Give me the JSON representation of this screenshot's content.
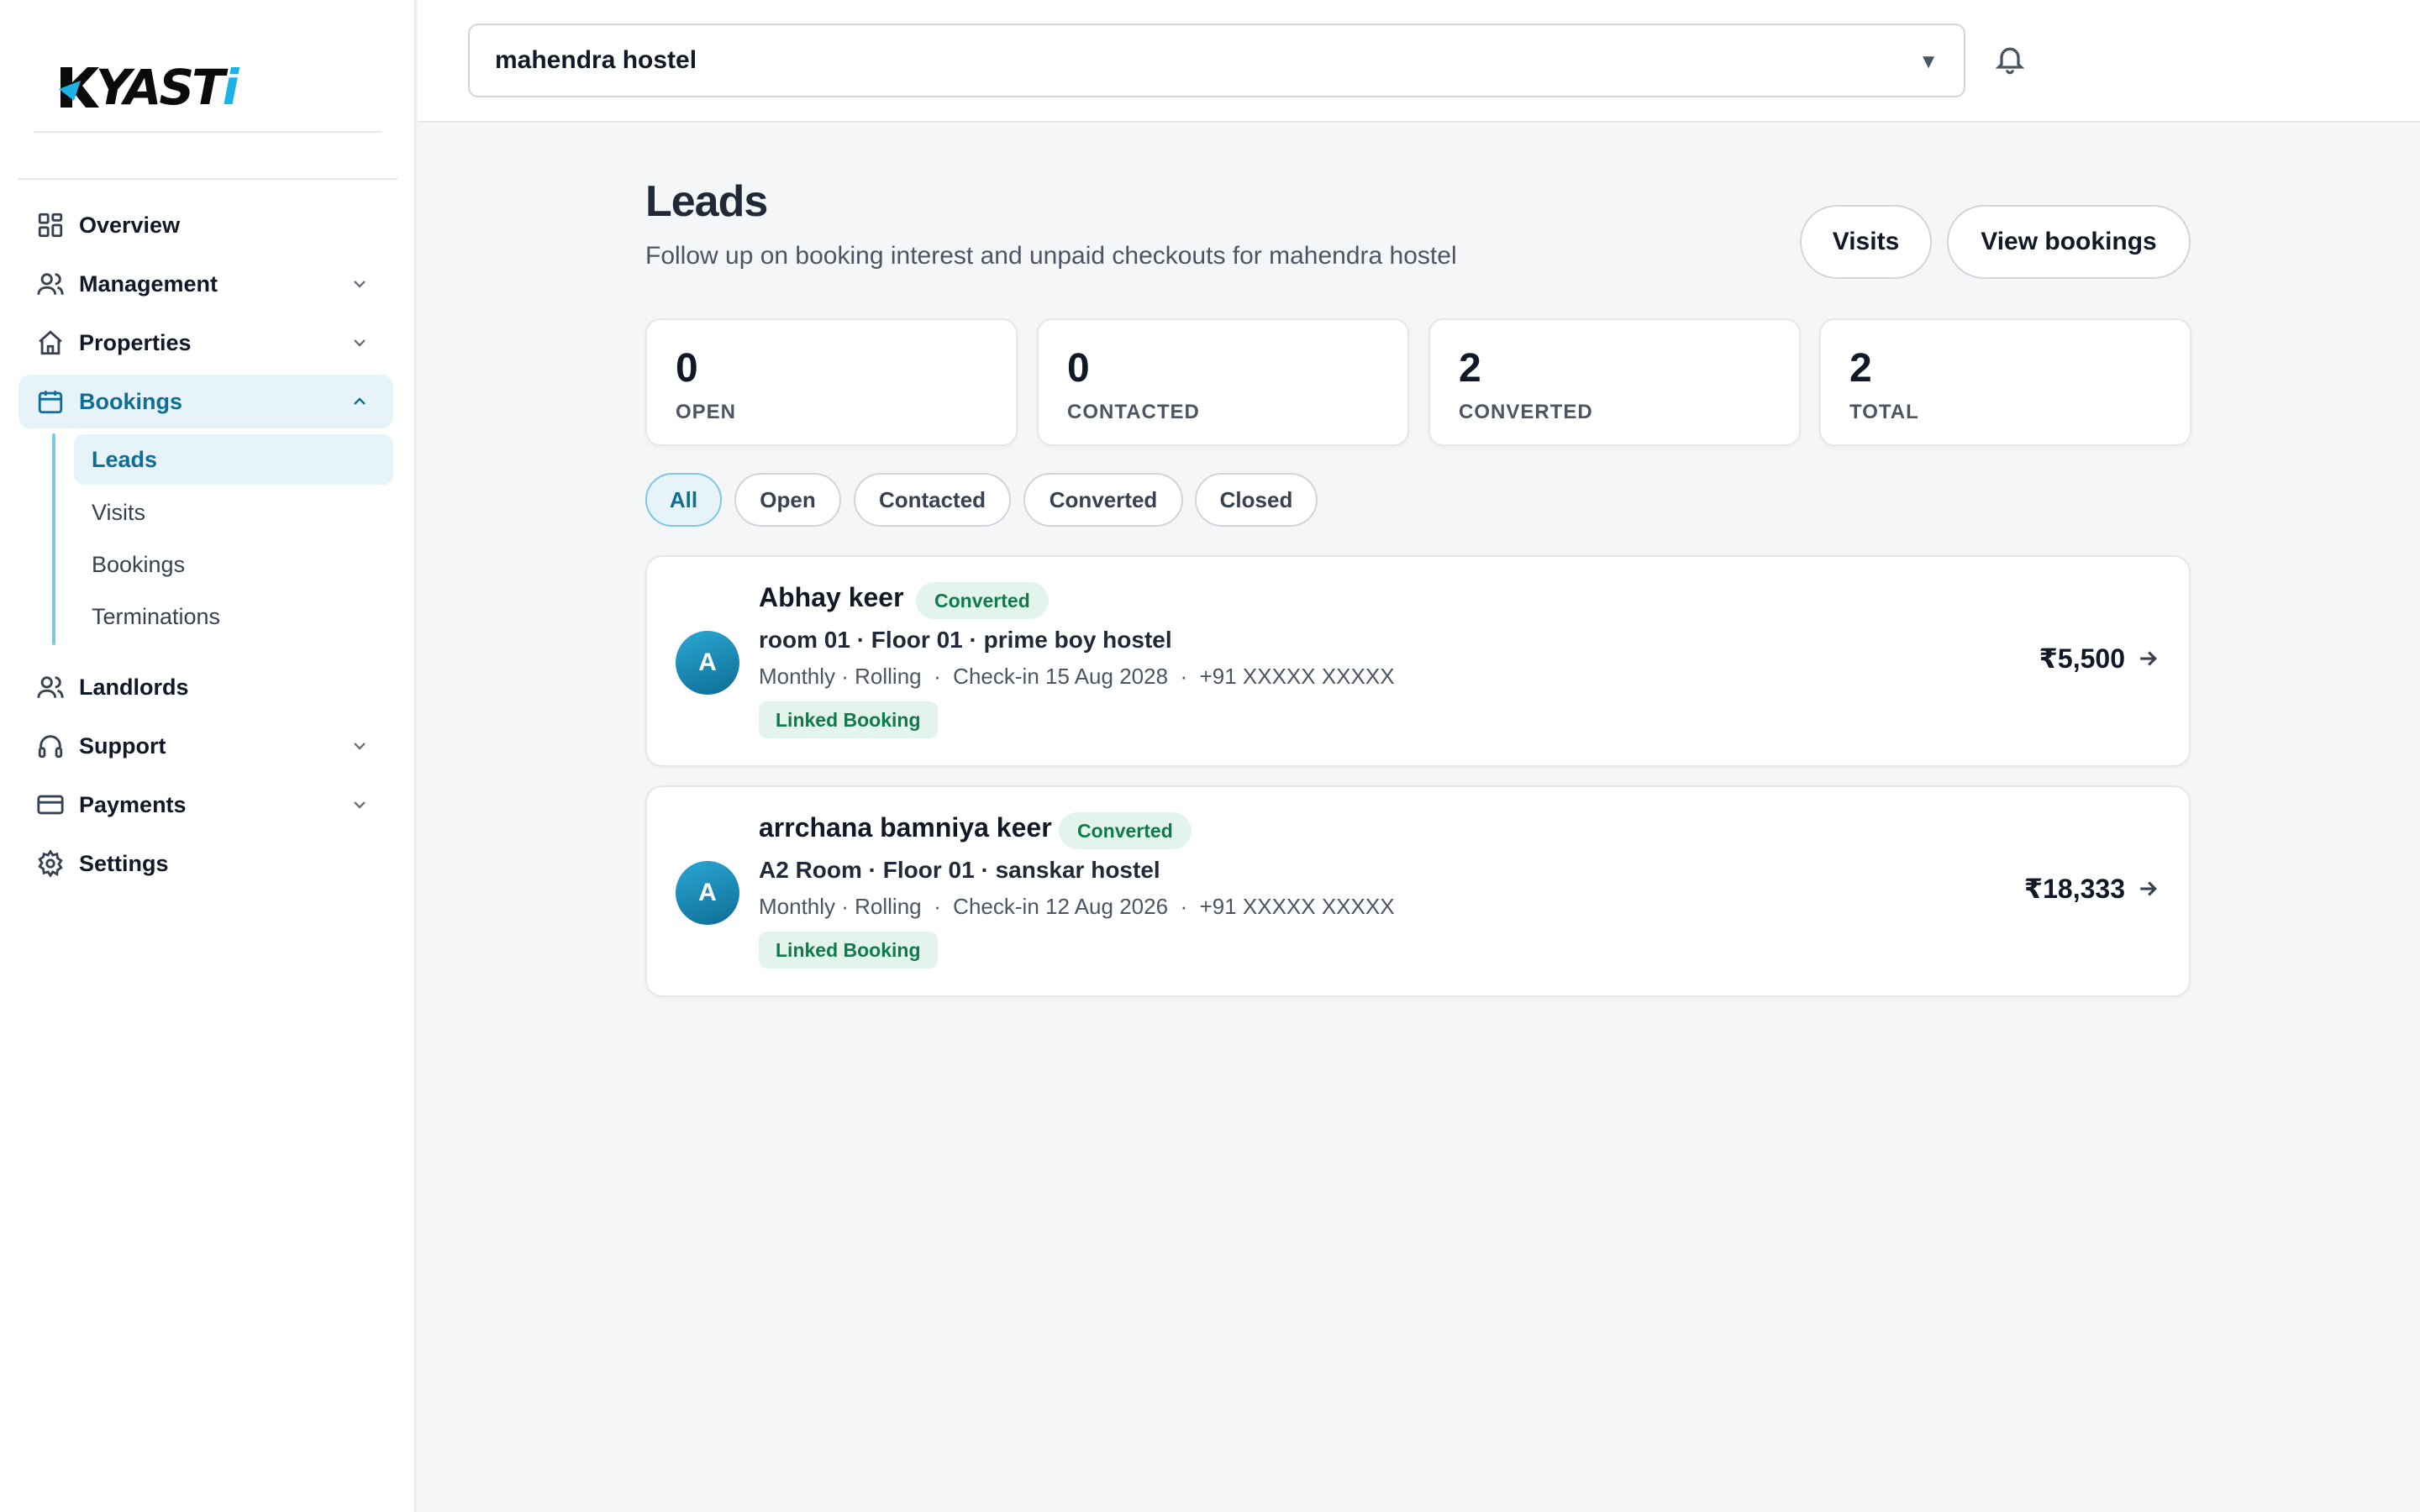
{
  "brand": {
    "logo_text": "KYASTi",
    "logo_main": "YAST",
    "logo_dot": "i"
  },
  "sidebar": {
    "items": [
      {
        "label": "Overview",
        "icon": "grid-icon"
      },
      {
        "label": "Management",
        "icon": "users-icon"
      },
      {
        "label": "Properties",
        "icon": "home-icon"
      },
      {
        "label": "Bookings",
        "icon": "calendar-icon"
      },
      {
        "label": "Landlords",
        "icon": "users-icon"
      },
      {
        "label": "Support",
        "icon": "headset-icon"
      },
      {
        "label": "Payments",
        "icon": "credit-card-icon"
      },
      {
        "label": "Settings",
        "icon": "gear-icon"
      }
    ],
    "bookings_sub": [
      {
        "label": "Leads",
        "active": true
      },
      {
        "label": "Visits"
      },
      {
        "label": "Bookings"
      },
      {
        "label": "Terminations"
      }
    ]
  },
  "topbar": {
    "property_selector": "mahendra hostel",
    "caret": "▼"
  },
  "header": {
    "title": "Leads",
    "subtitle": "Follow up on booking interest and unpaid checkouts for mahendra hostel",
    "visits_button": "Visits",
    "view_bookings_button": "View bookings"
  },
  "stats": [
    {
      "value": "0",
      "label": "OPEN"
    },
    {
      "value": "0",
      "label": "CONTACTED"
    },
    {
      "value": "2",
      "label": "CONVERTED"
    },
    {
      "value": "2",
      "label": "TOTAL"
    }
  ],
  "filters": [
    "All",
    "Open",
    "Contacted",
    "Converted",
    "Closed"
  ],
  "active_filter": "All",
  "leads": [
    {
      "initial": "A",
      "name": "Abhay keer",
      "status": "Converted",
      "room": "room 01 · Floor 01 · prime boy hostel",
      "meta": "Monthly · Rolling  ·  Check-in 15 Aug 2028  ·  +91 XXXXX XXXXX",
      "tag": "Linked Booking",
      "amount": "₹5,500"
    },
    {
      "initial": "A",
      "name": "arrchana bamniya keer",
      "status": "Converted",
      "room": "A2 Room · Floor 01 · sanskar hostel",
      "meta": "Monthly · Rolling  ·  Check-in 12 Aug 2026  ·  +91 XXXXX XXXXX",
      "tag": "Linked Booking",
      "amount": "₹18,333"
    }
  ],
  "colors": {
    "accent": "#0e6e96",
    "accent_bg": "#e6f4fa",
    "success": "#0f7a4d",
    "success_bg": "#e3f4ec",
    "page_bg": "#f5f6f8"
  }
}
